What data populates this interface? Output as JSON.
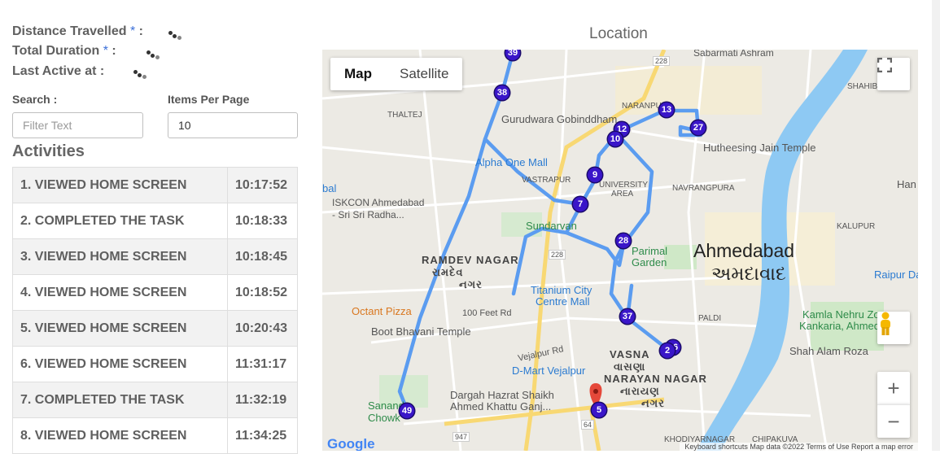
{
  "info": {
    "distance_label": "Distance Travelled",
    "duration_label": "Total Duration",
    "last_active_label": "Last Active at :",
    "required_mark": "*",
    "colon": ":"
  },
  "search": {
    "label": "Search :",
    "placeholder": "Filter Text"
  },
  "items_per_page": {
    "label": "Items Per Page",
    "value": "10"
  },
  "activities": {
    "title": "Activities",
    "rows": [
      {
        "name": "1.  VIEWED HOME SCREEN",
        "time": "10:17:52"
      },
      {
        "name": "2.  COMPLETED THE TASK",
        "time": "10:18:33"
      },
      {
        "name": "3.  VIEWED HOME SCREEN",
        "time": "10:18:45"
      },
      {
        "name": "4.  VIEWED HOME SCREEN",
        "time": "10:18:52"
      },
      {
        "name": "5.  VIEWED HOME SCREEN",
        "time": "10:20:43"
      },
      {
        "name": "6.  VIEWED HOME SCREEN",
        "time": "11:31:17"
      },
      {
        "name": "7.  COMPLETED THE TASK",
        "time": "11:32:19"
      },
      {
        "name": "8.  VIEWED HOME SCREEN",
        "time": "11:34:25"
      }
    ]
  },
  "location": {
    "title": "Location",
    "map_type": {
      "map": "Map",
      "satellite": "Satellite"
    },
    "zoom_in": "+",
    "zoom_out": "−",
    "markers": [
      "39",
      "38",
      "13",
      "27",
      "12",
      "10",
      "9",
      "7",
      "28",
      "37",
      "36",
      "2",
      "49",
      "5"
    ],
    "labels": {
      "city": "Ahmedabad",
      "city_gu": "અમદાવાદ",
      "ramdev": "RAMDEV NAGAR",
      "ramdev_gu": "રામદેવ",
      "ramdev_gu2": "નગર",
      "vasna": "VASNA",
      "vasna_gu": "વાસણા",
      "narayan": "NARAYAN NAGAR",
      "narayan_gu": "નારાયણ",
      "narayan_gu2": "નગર",
      "gurudwara": "Gurudwara Gobinddham",
      "alpha": "Alpha One Mall",
      "vastrapur": "VASTRAPUR",
      "university": "UNIVERSITY",
      "university2": "AREA",
      "navrangpura": "NAVRANGPURA",
      "iskcon": "ISKCON Ahmedabad",
      "iskcon2": "- Sri Sri Radha...",
      "sundarvan": "Sundarvan",
      "parimal": "Parimal",
      "parimal2": "Garden",
      "titanium": "Titanium City",
      "titanium2": "Centre Mall",
      "octant": "Octant Pizza",
      "feet": "100 Feet Rd",
      "boot": "Boot Bhavani Temple",
      "vejalpur": "Vejalpur Rd",
      "dmart": "D-Mart Vejalpur",
      "dargah": "Dargah Hazrat Shaikh",
      "dargah2": "Ahmed Khattu Ganj...",
      "sanand": "Sanand",
      "chowk": "Chowk",
      "hutheesing": "Hutheesing Jain Temple",
      "sabarmati": "Sabarmati Ashram",
      "kalupur": "KALUPUR",
      "raipur": "Raipur Da",
      "kamla": "Kamla Nehru Zoo",
      "kankaria": "Kankaria, Ahmedab",
      "shah": "Shah Alam Roza",
      "paldi": "PALDI",
      "thaltej": "THALTEJ",
      "naranpura": "NARANPU",
      "shahibag": "SHAHIB",
      "khodiyar": "KHODIYARNAGAR",
      "chipakuva": "CHIPAKUVA",
      "han": "Han",
      "bal": "bal",
      "r228": "228",
      "r947": "947",
      "r64": "64",
      "google": "Google",
      "footer": "Keyboard shortcuts   Map data ©2022   Terms of Use   Report a map error"
    }
  },
  "colors": {
    "marker": "#3a16c9",
    "route": "#5b9cf0",
    "river": "#7fc4f5",
    "pin": "#e5483a"
  }
}
